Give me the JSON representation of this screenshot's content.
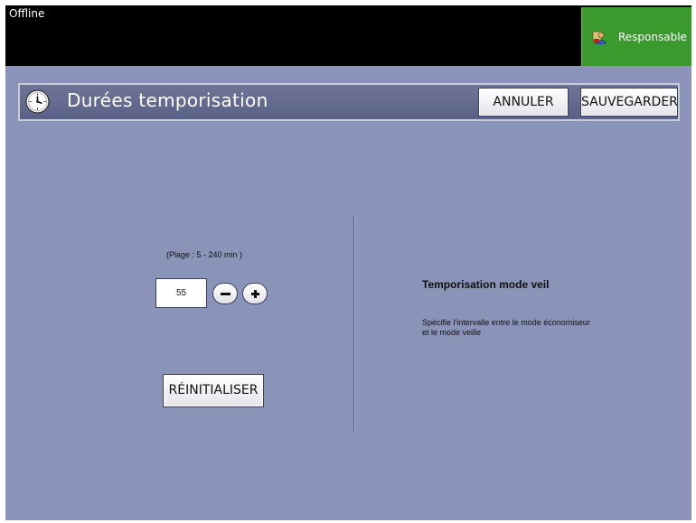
{
  "status_bar": {
    "status": "Offline"
  },
  "user": {
    "role": "Responsable",
    "icon": "admin-user-icon"
  },
  "header": {
    "title": "Durées temporisation",
    "icon": "clock-icon",
    "cancel_label": "ANNULER",
    "save_label": "SAUVEGARDER"
  },
  "setting": {
    "range_label": "(Plage :  5 - 240 min )",
    "value": "55",
    "decrement_icon": "minus-icon",
    "increment_icon": "plus-icon",
    "reset_label": "RÉINITIALISER"
  },
  "info": {
    "title": "Temporisation mode veil",
    "description": "Spécifie l'intervalle entre le mode économiseur et le mode veille"
  },
  "colors": {
    "background": "#8a93b8",
    "title_bar": "#5f6690",
    "role_badge": "#3a9a2e",
    "top_bar": "#000000"
  }
}
